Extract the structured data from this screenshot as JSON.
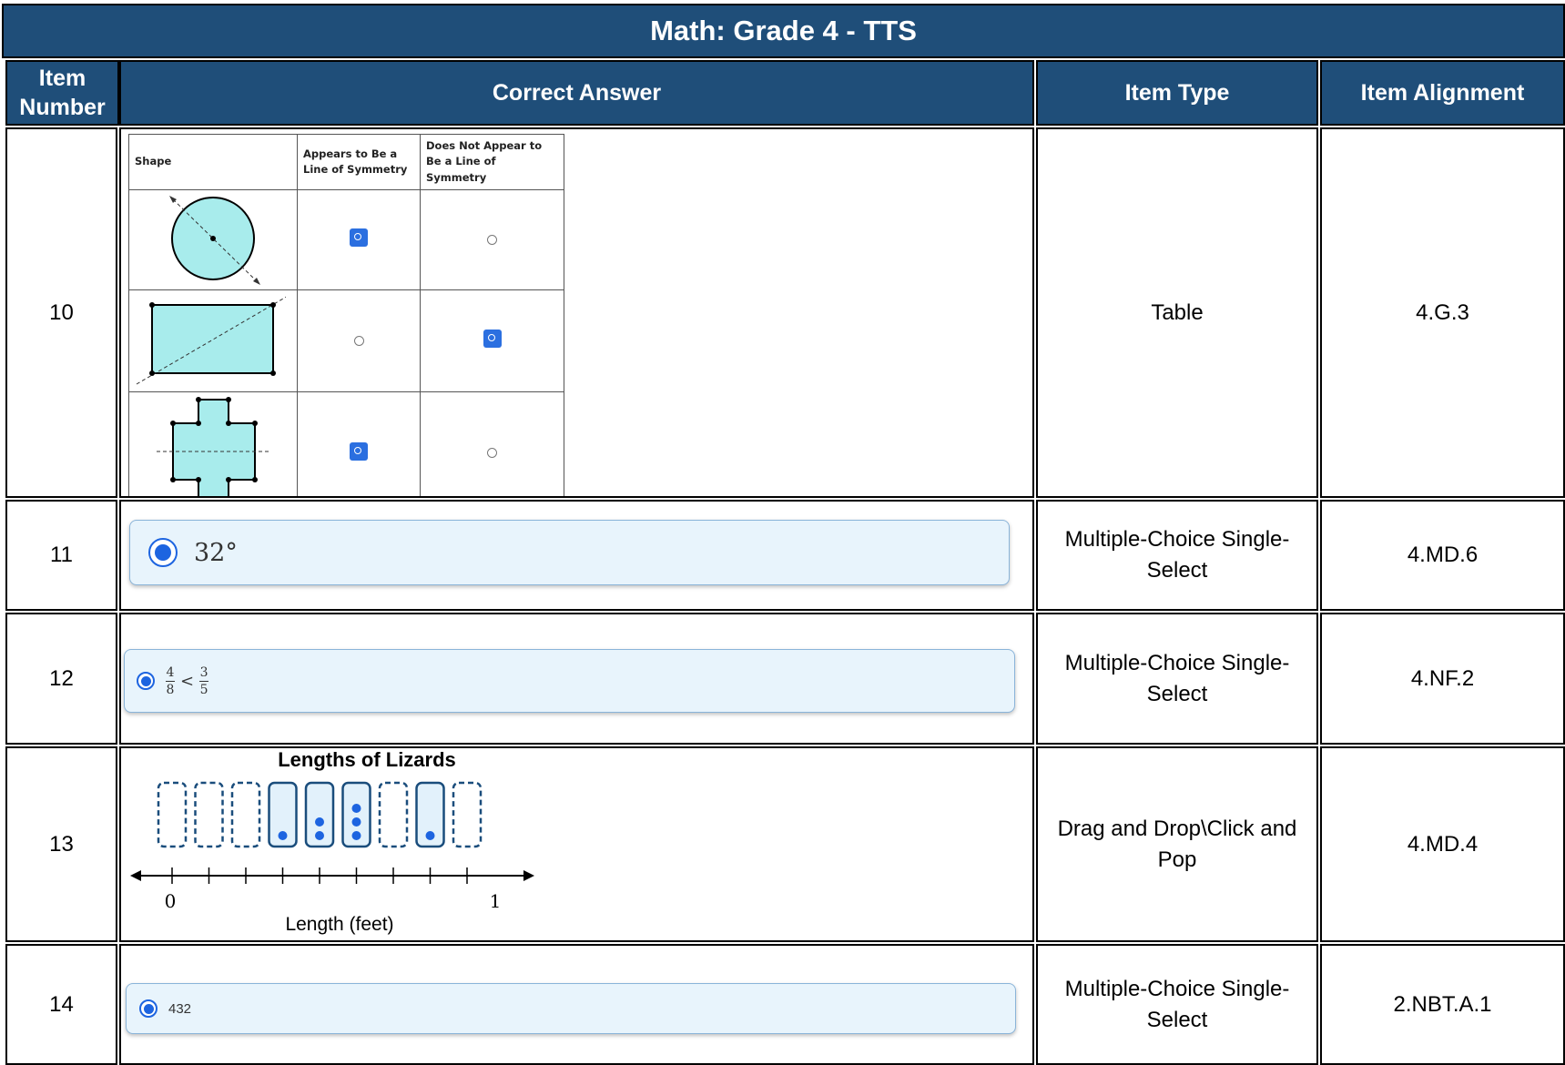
{
  "title": "Math: Grade 4 - TTS",
  "columns": {
    "item_number": "Item Number",
    "correct_answer": "Correct Answer",
    "item_type": "Item Type",
    "item_alignment": "Item Alignment"
  },
  "rows": [
    {
      "number": "10",
      "type": "Table",
      "alignment": "4.G.3",
      "table": {
        "headers": [
          "Shape",
          "Appears to Be a Line of Symmetry",
          "Does Not Appear to Be a Line of Symmetry"
        ],
        "rows": [
          {
            "shape": "circle-with-diagonal-line",
            "appears": true,
            "does_not_appear": false
          },
          {
            "shape": "rectangle-with-diagonal-line",
            "appears": false,
            "does_not_appear": true
          },
          {
            "shape": "cross-with-horizontal-line",
            "appears": true,
            "does_not_appear": false
          }
        ]
      }
    },
    {
      "number": "11",
      "type": "Multiple-Choice Single-Select",
      "alignment": "4.MD.6",
      "answer": "32°"
    },
    {
      "number": "12",
      "type": "Multiple-Choice Single-Select",
      "alignment": "4.NF.2",
      "answer": {
        "left_num": "4",
        "left_den": "8",
        "op": "<",
        "right_num": "3",
        "right_den": "5"
      }
    },
    {
      "number": "13",
      "type": "Drag and Drop\\Click and Pop",
      "alignment": "4.MD.4",
      "line_plot": {
        "title": "Lengths of Lizards",
        "xlabel": "Length (feet)",
        "tick_start": "0",
        "tick_end": "1",
        "dot_counts": [
          0,
          0,
          0,
          1,
          2,
          3,
          0,
          1,
          0
        ]
      }
    },
    {
      "number": "14",
      "type": "Multiple-Choice Single-Select",
      "alignment": "2.NBT.A.1",
      "answer": "432"
    }
  ],
  "colors": {
    "header_bg": "#1f4e79",
    "accent": "#1d64e0",
    "choice_bg": "#e8f4fc"
  }
}
